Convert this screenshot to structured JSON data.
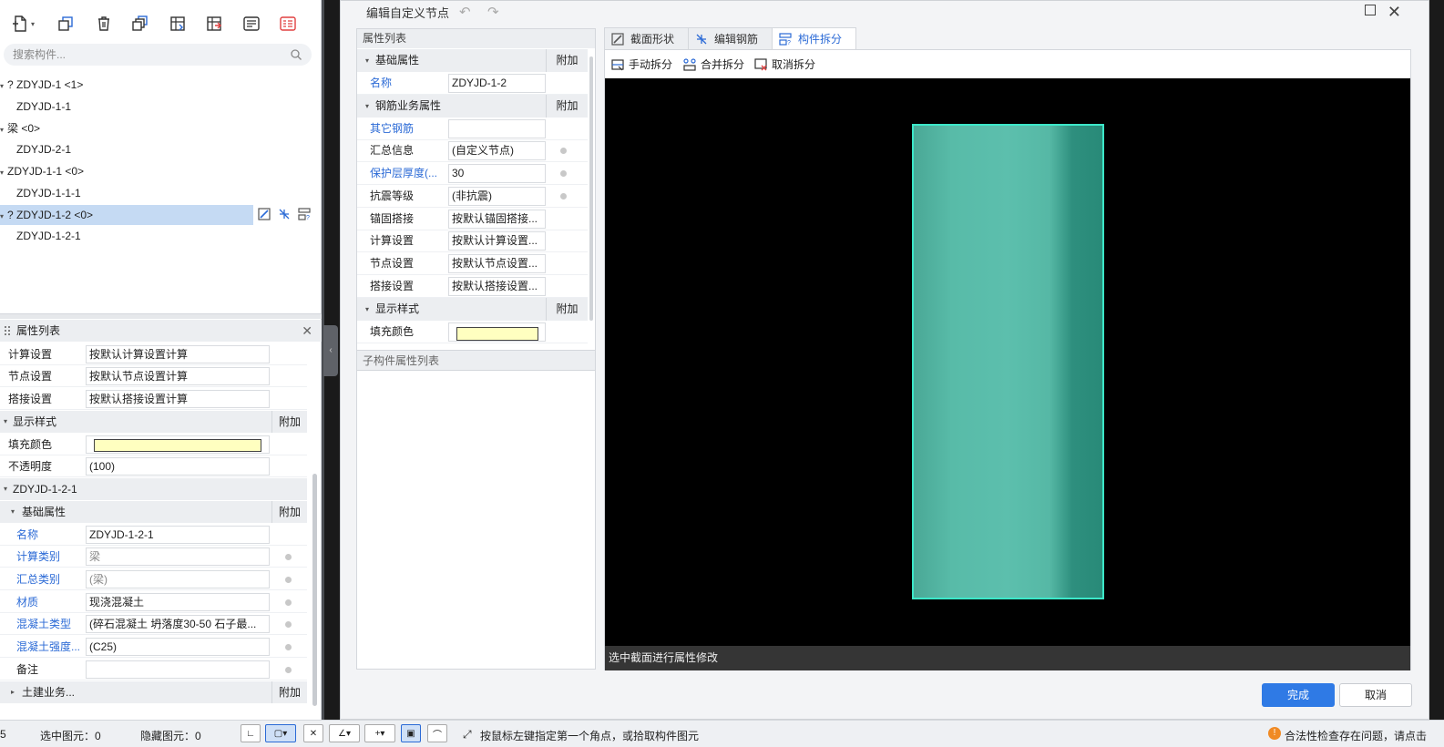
{
  "left": {
    "search_placeholder": "搜索构件...",
    "tree": [
      {
        "label": "? ZDYJD-1 <1>",
        "level": 0
      },
      {
        "label": "ZDYJD-1-1",
        "level": 1
      },
      {
        "label": "梁 <0>",
        "level": 0
      },
      {
        "label": "ZDYJD-2-1",
        "level": 1
      },
      {
        "label": "ZDYJD-1-1 <0>",
        "level": 0
      },
      {
        "label": "ZDYJD-1-1-1",
        "level": 1
      },
      {
        "label": "? ZDYJD-1-2 <0>",
        "level": 0,
        "selected": true
      },
      {
        "label": "ZDYJD-1-2-1",
        "level": 1
      }
    ],
    "props_title": "属性列表",
    "props": {
      "calc_setting": {
        "label": "计算设置",
        "value": "按默认计算设置计算"
      },
      "node_setting": {
        "label": "节点设置",
        "value": "按默认节点设置计算"
      },
      "lap_setting": {
        "label": "搭接设置",
        "value": "按默认搭接设置计算"
      },
      "display_section": "显示样式",
      "attach": "附加",
      "fill_color": {
        "label": "填充颜色",
        "color": "#ffffc0"
      },
      "opacity": {
        "label": "不透明度",
        "value": "(100)"
      },
      "sub_component": "ZDYJD-1-2-1",
      "basic_section": "基础属性",
      "name": {
        "label": "名称",
        "value": "ZDYJD-1-2-1"
      },
      "calc_type": {
        "label": "计算类别",
        "value": "梁"
      },
      "summary_type": {
        "label": "汇总类别",
        "value": "(梁)"
      },
      "material": {
        "label": "材质",
        "value": "现浇混凝土"
      },
      "concrete_type": {
        "label": "混凝土类型",
        "value": "(碎石混凝土 坍落度30-50 石子最..."
      },
      "concrete_strength": {
        "label": "混凝土强度...",
        "value": "(C25)"
      },
      "remark": {
        "label": "备注",
        "value": ""
      },
      "civil_section": "土建业务..."
    }
  },
  "dialog": {
    "title": "编辑自定义节点",
    "panel_title": "属性列表",
    "basic_section": "基础属性",
    "attach": "附加",
    "name": {
      "label": "名称",
      "value": "ZDYJD-1-2"
    },
    "rebar_section": "钢筋业务属性",
    "other_rebar": {
      "label": "其它钢筋",
      "value": ""
    },
    "summary_info": {
      "label": "汇总信息",
      "value": "(自定义节点)"
    },
    "cover": {
      "label": "保护层厚度(...",
      "value": "30"
    },
    "seismic": {
      "label": "抗震等级",
      "value": "(非抗震)"
    },
    "anchor": {
      "label": "锚固搭接",
      "value": "按默认锚固搭接..."
    },
    "calc": {
      "label": "计算设置",
      "value": "按默认计算设置..."
    },
    "node": {
      "label": "节点设置",
      "value": "按默认节点设置..."
    },
    "lap": {
      "label": "搭接设置",
      "value": "按默认搭接设置..."
    },
    "display_section": "显示样式",
    "fill_color": {
      "label": "填充颜色",
      "color": "#ffffc0"
    },
    "child_props_title": "子构件属性列表",
    "tabs": [
      "截面形状",
      "编辑钢筋",
      "构件拆分"
    ],
    "active_tab": 2,
    "subtools": [
      "手动拆分",
      "合并拆分",
      "取消拆分"
    ],
    "canvas_status": "选中截面进行属性修改",
    "ok": "完成",
    "cancel": "取消",
    "beam_color": "#3ce8c9"
  },
  "statusbar": {
    "left_num": "5",
    "selected": "选中图元：0",
    "hidden": "隐藏图元：0",
    "hint": "按鼠标左键指定第一个角点，或拾取构件图元",
    "warning": "合法性检查存在问题，请点击"
  },
  "colors": {
    "accent": "#2f7ae5",
    "selected_row": "#c5daf3",
    "link_label": "#2b6ad6"
  }
}
